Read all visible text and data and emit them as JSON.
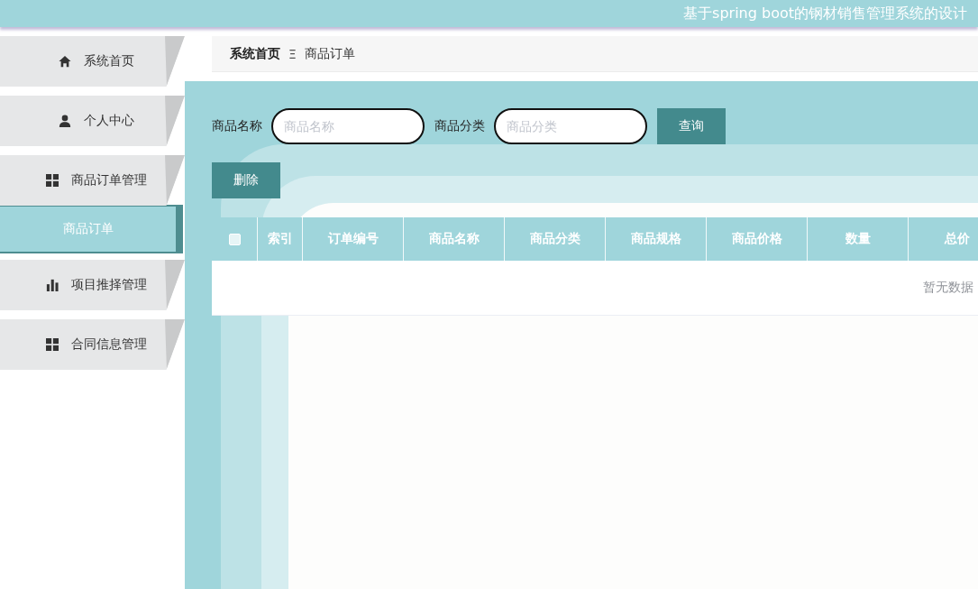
{
  "header": {
    "title": "基于spring boot的钢材销售管理系统的设计"
  },
  "sidebar": {
    "items": [
      {
        "label": "系统首页",
        "kind": "home",
        "selected": false
      },
      {
        "label": "个人中心",
        "kind": "user",
        "selected": false
      },
      {
        "label": "商品订单管理",
        "kind": "grid",
        "selected": false,
        "children": [
          {
            "label": "商品订单",
            "selected": true
          }
        ]
      },
      {
        "label": "项目推择管理",
        "kind": "chart",
        "selected": false
      },
      {
        "label": "合同信息管理",
        "kind": "grid",
        "selected": false
      }
    ]
  },
  "breadcrumb": {
    "items": [
      "系统首页",
      "商品订单"
    ],
    "separator": "Ξ"
  },
  "search": {
    "fields": [
      {
        "label": "商品名称",
        "placeholder": "商品名称"
      },
      {
        "label": "商品分类",
        "placeholder": "商品分类"
      }
    ],
    "button": "查询"
  },
  "actions": [
    "删除"
  ],
  "table": {
    "select_all": {
      "checked": false
    },
    "columns": [
      "索引",
      "订单编号",
      "商品名称",
      "商品分类",
      "商品规格",
      "商品价格",
      "数量",
      "总价"
    ],
    "empty_text": "暂无数据"
  }
}
